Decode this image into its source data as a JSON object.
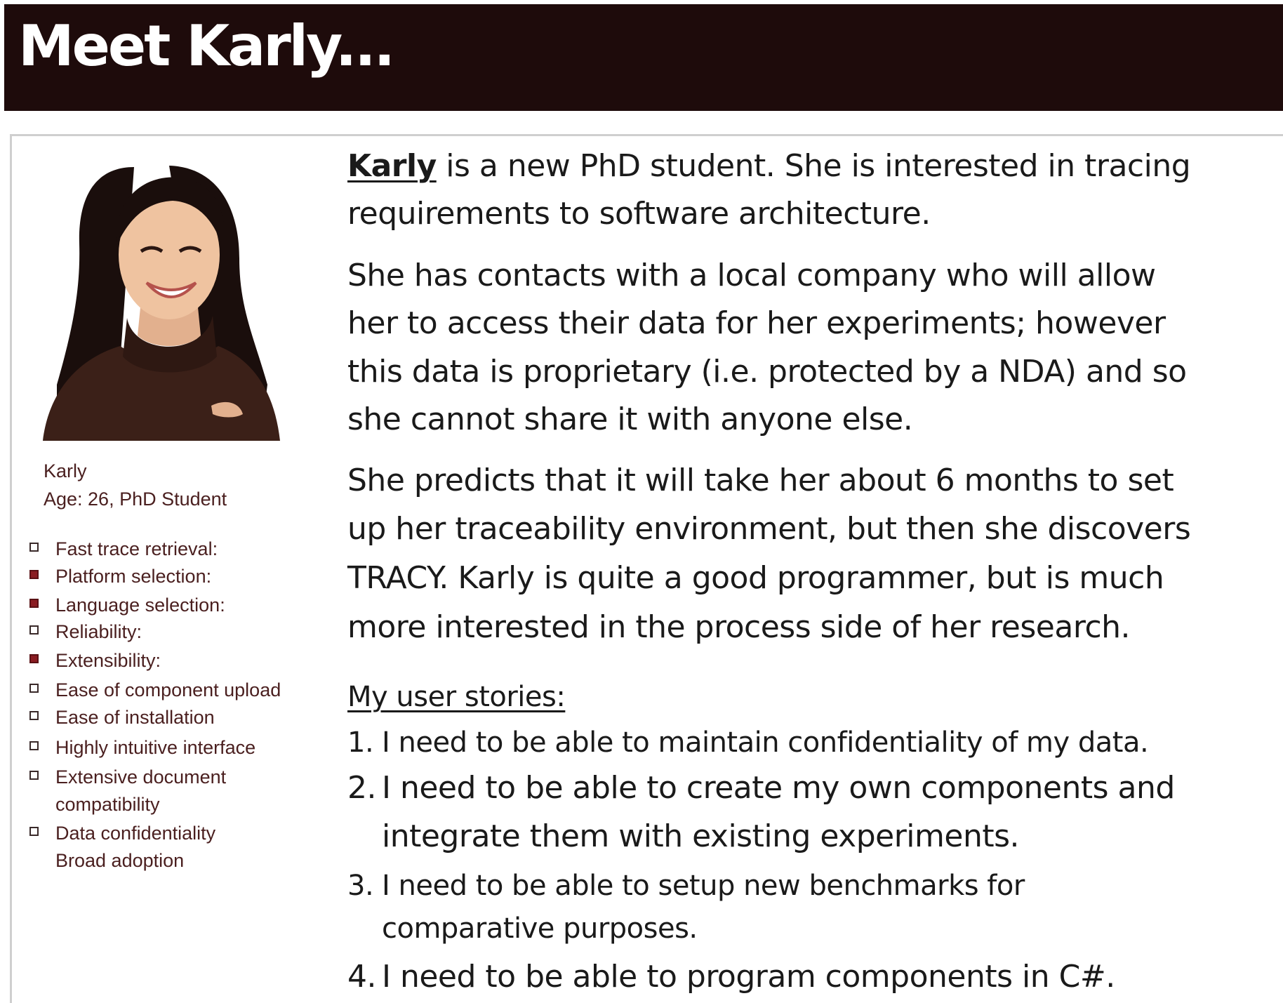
{
  "title": "Meet Karly...",
  "persona": {
    "name": "Karly",
    "age_line": "Age: 26, PhD Student",
    "photo": "smiling-woman-portrait"
  },
  "criteria": [
    {
      "label": "Fast trace retrieval:",
      "checked": false
    },
    {
      "label": "Platform selection:",
      "checked": true
    },
    {
      "label": "Language selection:",
      "checked": true
    },
    {
      "label": "Reliability:",
      "checked": false
    },
    {
      "label": "Extensibility:",
      "checked": true
    },
    {
      "label": "Ease of component upload",
      "checked": false
    },
    {
      "label": "Ease of installation",
      "checked": false
    },
    {
      "label": "Highly intuitive interface",
      "checked": false
    },
    {
      "label": "Extensive document",
      "label_cont": "compatibility",
      "checked": false
    },
    {
      "label": "Data confidentiality",
      "label_cont": "Broad adoption",
      "checked": false
    }
  ],
  "paragraphs": {
    "p1_name": "Karly",
    "p1_rest": " is a new PhD student.  She is interested in tracing",
    "p1_line2": "requirements to software architecture.",
    "p2_lines": [
      "She has contacts with a local company who will allow",
      "her to access their data for her experiments; however",
      "this data is proprietary (i.e. protected by a NDA) and so",
      "she cannot share it with anyone else."
    ],
    "p3_lines": [
      "She predicts that it will take her about 6 months to set",
      "up her traceability environment, but then she discovers",
      "TRACY.  Karly is quite a good programmer, but is much",
      "more interested in the process side of her research."
    ]
  },
  "stories": {
    "heading": "My user stories:",
    "items": [
      {
        "num": "1.",
        "lines": [
          "I need to be able to maintain confidentiality of my data."
        ]
      },
      {
        "num": "2.",
        "lines": [
          "I need to be able to create my own components and",
          "integrate them with existing experiments."
        ]
      },
      {
        "num": "3.",
        "lines": [
          "I need to be able to setup new benchmarks for",
          "comparative purposes."
        ]
      },
      {
        "num": "4.",
        "lines": [
          "I need to be able to program components in C#."
        ]
      }
    ]
  },
  "colors": {
    "header_bg": "#1e0b0b",
    "checked_box": "#8a1c22",
    "criteria_text": "#4a1f1f"
  }
}
